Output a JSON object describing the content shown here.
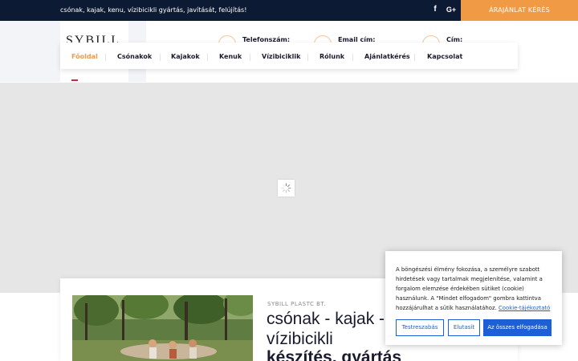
{
  "topbar": {
    "tagline": "csónak, kajak, kenu, vízibicikli gyártás, javítását, felújítás!",
    "facebook_glyph": "f",
    "googleplus_glyph": "G+",
    "quote_button": "ÁRAJÁNLAT KÉRÉS"
  },
  "header": {
    "logo": "SYBILL",
    "contacts": [
      {
        "title": "Telefonszám:",
        "icon": "phone-icon"
      },
      {
        "title": "Email cím:",
        "icon": "mail-icon"
      },
      {
        "title": "Cím:",
        "icon": "location-icon"
      }
    ]
  },
  "nav": {
    "items": [
      "Főoldal",
      "Csónakok",
      "Kajakok",
      "Kenuk",
      "Vízibiciklik",
      "Rólunk",
      "Ajánlatkérés",
      "Kapcsolat"
    ],
    "active_index": 0,
    "language": "hungarian-flag-icon"
  },
  "content": {
    "company": "SYBILL PLASTC BT.",
    "headline_line1": "csónak - kajak -",
    "headline_line2": "vízibicikli",
    "headline_line3": "készítés, gyártás"
  },
  "cookie": {
    "text": "A böngészési élmény fokozása, a személyre szabott hirdetések vagy tartalmak megjelenítése, valamint a forgalom elemzése érdekében sütiket (cookie) használunk. A \"Mindet elfogadom\" gombra kattintva hozzájárulhat a sütik használatához.",
    "link": "Cookie-tájékoztató",
    "buttons": {
      "customize": "Testreszabás",
      "reject": "Elutasít",
      "accept_all": "Az összes elfogadása"
    }
  },
  "colors": {
    "topbar": "#0d1a33",
    "accent": "#f19a46",
    "cookie_blue": "#1c5fd6"
  }
}
